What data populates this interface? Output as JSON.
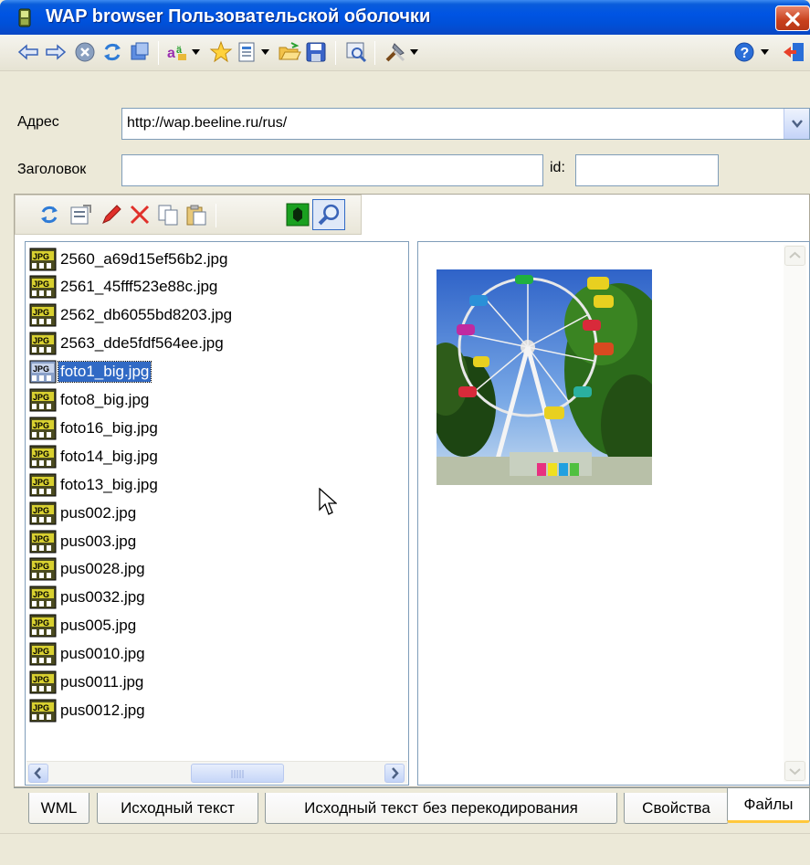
{
  "window": {
    "title": "WAP browser Пользовательской оболочки"
  },
  "toolbar": {
    "icons": [
      "back-icon",
      "forward-icon",
      "stop-icon",
      "refresh-icon",
      "home-icon",
      "encoding-icon",
      "favorites-icon",
      "page-icon",
      "open-icon",
      "save-icon",
      "view-icon",
      "tools-icon",
      "help-icon",
      "exit-icon"
    ]
  },
  "address": {
    "label": "Адрес",
    "value": "http://wap.beeline.ru/rus/"
  },
  "header": {
    "label": "Заголовок",
    "value": ""
  },
  "id": {
    "label": "id:",
    "value": ""
  },
  "files_toolbar": {
    "icons": [
      "refresh-icon",
      "properties-icon",
      "edit-icon",
      "delete-icon",
      "copy-icon",
      "paste-icon",
      "virus-check-icon",
      "search-icon"
    ]
  },
  "files": [
    "2560_a69d15ef56b2.jpg",
    "2561_45fff523e88c.jpg",
    "2562_db6055bd8203.jpg",
    "2563_dde5fdf564ee.jpg",
    "foto1_big.jpg",
    "foto8_big.jpg",
    "foto16_big.jpg",
    "foto14_big.jpg",
    "foto13_big.jpg",
    "pus002.jpg",
    "pus003.jpg",
    "pus0028.jpg",
    "pus0032.jpg",
    "pus005.jpg",
    "pus0010.jpg",
    "pus0011.jpg",
    "pus0012.jpg"
  ],
  "selected_file": "foto1_big.jpg",
  "file_icon_label": "JPG",
  "tabs": [
    "WML",
    "Исходный текст",
    "Исходный текст без перекодирования",
    "Свойства",
    "Файлы"
  ],
  "active_tab": "Файлы"
}
